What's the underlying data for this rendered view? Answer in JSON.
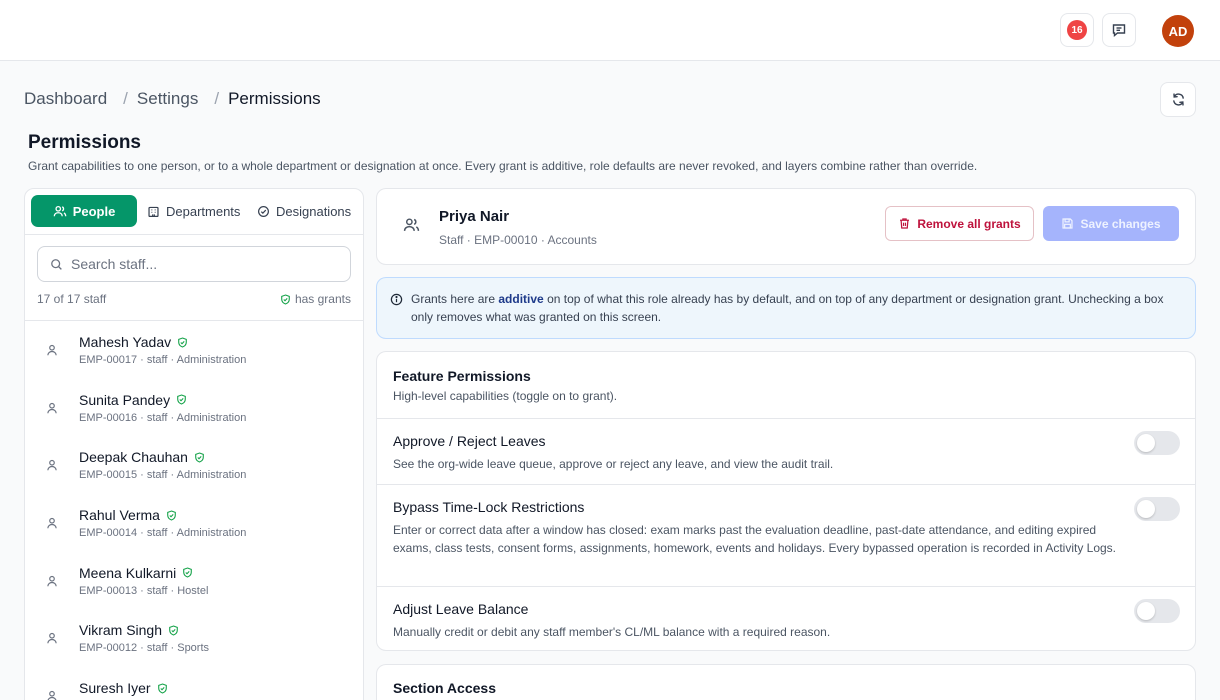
{
  "topbar": {
    "notification_count": "16",
    "avatar_initials": "AD",
    "icons": [
      "bell-badge-icon",
      "chat-icon"
    ]
  },
  "breadcrumb": {
    "items": [
      "Dashboard",
      "Settings",
      "Permissions"
    ],
    "separator": "/"
  },
  "page": {
    "title": "Permissions",
    "subtitle": "Grant capabilities to one person, or to a whole department or designation at once. Every grant is additive, role defaults are never revoked, and layers combine rather than override."
  },
  "tabs": [
    {
      "label": "People",
      "icon": "people-icon",
      "active": true
    },
    {
      "label": "Departments",
      "icon": "building-icon",
      "active": false
    },
    {
      "label": "Designations",
      "icon": "badge-check-icon",
      "active": false
    }
  ],
  "search": {
    "placeholder": "Search staff...",
    "value": ""
  },
  "list_meta": {
    "count": "17 of 17 staff",
    "legend": "has grants"
  },
  "staff": [
    {
      "name": "Mahesh Yadav",
      "meta": "EMP-00017 · staff · Administration"
    },
    {
      "name": "Sunita Pandey",
      "meta": "EMP-00016 · staff · Administration"
    },
    {
      "name": "Deepak Chauhan",
      "meta": "EMP-00015 · staff · Administration"
    },
    {
      "name": "Rahul Verma",
      "meta": "EMP-00014 · staff · Administration"
    },
    {
      "name": "Meena Kulkarni",
      "meta": "EMP-00013 · staff · Hostel"
    },
    {
      "name": "Vikram Singh",
      "meta": "EMP-00012 · staff · Sports"
    },
    {
      "name": "Suresh Iyer",
      "meta": ""
    }
  ],
  "selected": {
    "name": "Priya Nair",
    "meta": "Staff · EMP-00010 · Accounts",
    "remove_label": "Remove all grants",
    "save_label": "Save changes"
  },
  "info": {
    "prefix": "Grants here are ",
    "bold": "additive",
    "suffix": " on top of what this role already has by default, and on top of any department or designation grant. Unchecking a box only removes what was granted on this screen."
  },
  "features": {
    "title": "Feature Permissions",
    "subtitle": "High-level capabilities (toggle on to grant).",
    "items": [
      {
        "title": "Approve / Reject Leaves",
        "desc": "See the org-wide leave queue, approve or reject any leave, and view the audit trail.",
        "enabled": false
      },
      {
        "title": "Bypass Time-Lock Restrictions",
        "desc": "Enter or correct data after a window has closed: exam marks past the evaluation deadline, past-date attendance, and editing expired exams, class tests, consent forms, assignments, homework, events and holidays. Every bypassed operation is recorded in Activity Logs.",
        "enabled": false
      },
      {
        "title": "Adjust Leave Balance",
        "desc": "Manually credit or debit any staff member's CL/ML balance with a required reason.",
        "enabled": false
      }
    ]
  },
  "section_access": {
    "title": "Section Access"
  },
  "colors": {
    "accent": "#059669",
    "danger": "#be123c",
    "primary_disabled": "#a5b4fc",
    "info_bg": "#eef6fc",
    "badge": "#ef4444",
    "avatar": "#c2410c"
  }
}
